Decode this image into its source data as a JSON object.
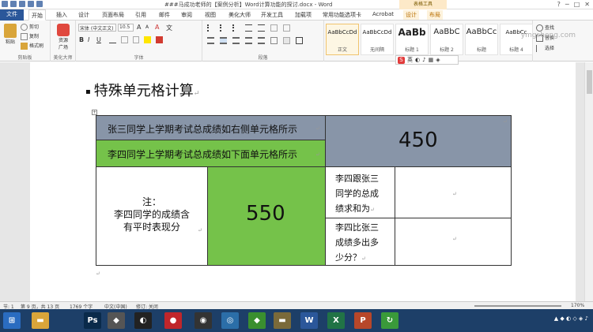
{
  "window": {
    "title": "###马成功老师的【案例分析】Word计算功能的探讨.docx - Word",
    "context_tools_label": "表格工具",
    "controls": [
      "?",
      "─",
      "□",
      "✕"
    ]
  },
  "tabs": [
    {
      "label": "文件",
      "kind": "file"
    },
    {
      "label": "开始",
      "kind": "active"
    },
    {
      "label": "插入"
    },
    {
      "label": "设计"
    },
    {
      "label": "页面布局"
    },
    {
      "label": "引用"
    },
    {
      "label": "邮件"
    },
    {
      "label": "审阅"
    },
    {
      "label": "视图"
    },
    {
      "label": "美化大师"
    },
    {
      "label": "开发工具"
    },
    {
      "label": "加载项"
    },
    {
      "label": "常用功能选项卡"
    },
    {
      "label": "Acrobat"
    },
    {
      "label": "设计",
      "kind": "ctx"
    },
    {
      "label": "布局",
      "kind": "ctx"
    }
  ],
  "ribbon": {
    "clipboard": {
      "paste": "粘贴",
      "cut": "剪切",
      "copy": "复制",
      "format_painter": "格式刷",
      "label": "剪贴板"
    },
    "beautify": {
      "resource": "资源",
      "plaza": "广场",
      "label": "美化大师"
    },
    "font": {
      "name": "宋体 (中文正文)",
      "size": "10.5",
      "grow": "A",
      "shrink": "A",
      "clear": "A",
      "wen": "文",
      "bold": "B",
      "italic": "I",
      "underline": "U",
      "label": "字体"
    },
    "paragraph": {
      "label": "段落"
    },
    "styles": [
      {
        "preview": "AaBbCcDd",
        "name": "正文",
        "selected": true
      },
      {
        "preview": "AaBbCcDd",
        "name": "无间隔"
      },
      {
        "preview": "AaBb",
        "name": "标题 1"
      },
      {
        "preview": "AaBbC",
        "name": "标题 2"
      },
      {
        "preview": "AaBbCc",
        "name": "标题"
      },
      {
        "preview": "AaBbCc",
        "name": "标题 4"
      }
    ],
    "editing": {
      "find": "查找",
      "replace": "替换",
      "select": "选择"
    }
  },
  "ime": {
    "logo": "S",
    "lang": "英"
  },
  "watermark": "ymgsheng.com",
  "document": {
    "heading": "特殊单元格计算",
    "table": {
      "row1_text": "张三同学上学期考试总成绩如右侧单元格所示",
      "row2_text": "李四同学上学期考试总成绩如下面单元格所示",
      "value_450": "450",
      "note_line1": "注：",
      "note_line2": "李四同学的成绩含",
      "note_line3": "有平时表现分",
      "value_550": "550",
      "q1_line1": "李四跟张三",
      "q1_line2": "同学的总成",
      "q1_line3": "绩求和为",
      "q2_line1": "李四比张三",
      "q2_line2": "成绩多出多",
      "q2_line3": "少分？"
    },
    "para_mark": "↵"
  },
  "status": {
    "section": "节: 1",
    "pages": "第 9 页，共 13 页",
    "words": "1769 个字",
    "lang": "中文(中国)",
    "revisions": "修订: 关闭",
    "zoom": "170%"
  },
  "taskbar": {
    "items": [
      {
        "icon": "windows-start-icon",
        "glyph": "⊞",
        "color": "#2a6cc0"
      },
      {
        "icon": "folder-icon",
        "glyph": "▬",
        "color": "#d9a53a"
      },
      {
        "icon": "photoshop-icon",
        "glyph": "Ps",
        "color": "#0a2a4a"
      },
      {
        "icon": "app-icon",
        "glyph": "◆",
        "color": "#555"
      },
      {
        "icon": "qq-icon",
        "glyph": "◐",
        "color": "#222"
      },
      {
        "icon": "recorder-icon",
        "glyph": "●",
        "color": "#c0262b"
      },
      {
        "icon": "camera-icon",
        "glyph": "◉",
        "color": "#333"
      },
      {
        "icon": "browser-icon",
        "glyph": "◎",
        "color": "#2b6ea8"
      },
      {
        "icon": "green-app-icon",
        "glyph": "◆",
        "color": "#3a8f2f"
      },
      {
        "icon": "folder2-icon",
        "glyph": "▬",
        "color": "#7a6a3a"
      },
      {
        "icon": "word-icon",
        "glyph": "W",
        "color": "#2b579a"
      },
      {
        "icon": "excel-icon",
        "glyph": "X",
        "color": "#217346"
      },
      {
        "icon": "powerpoint-icon",
        "glyph": "P",
        "color": "#b7472a"
      },
      {
        "icon": "refresh-icon",
        "glyph": "↻",
        "color": "#3a9a3a"
      }
    ],
    "tray": "▲ ◆ ◐ ◇ ◈ ♪"
  }
}
